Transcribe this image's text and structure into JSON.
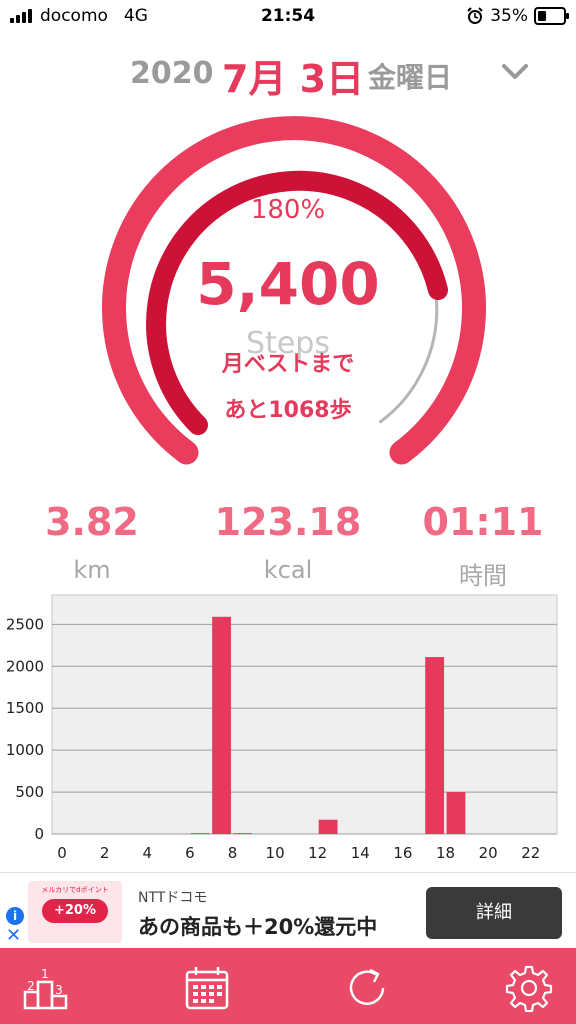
{
  "status_bar": {
    "carrier": "docomo",
    "network": "4G",
    "time": "21:54",
    "battery": "35%",
    "battery_level": 0.35,
    "icons": [
      "signal-icon",
      "alarm-icon",
      "battery-icon"
    ]
  },
  "date_header": {
    "year": "2020",
    "month_day": "7月 3日",
    "weekday": "金曜日",
    "toggle_icon": "chevron-down-icon"
  },
  "progress": {
    "percent_label": "180%",
    "percent_value": 180,
    "steps": "5,400",
    "steps_label": "Steps",
    "best_line1": "月ベストまで",
    "best_line2": "あと1068歩"
  },
  "stats": [
    {
      "value": "3.82",
      "unit": "km"
    },
    {
      "value": "123.18",
      "unit": "kcal"
    },
    {
      "value": "01:11",
      "unit": "時間"
    }
  ],
  "chart_data": {
    "type": "bar",
    "categories": [
      0,
      1,
      2,
      3,
      4,
      5,
      6,
      7,
      8,
      9,
      10,
      11,
      12,
      13,
      14,
      15,
      16,
      17,
      18,
      19,
      20,
      21,
      22,
      23
    ],
    "values": [
      0,
      0,
      0,
      0,
      0,
      0,
      10,
      2590,
      10,
      0,
      0,
      0,
      170,
      0,
      0,
      0,
      0,
      2110,
      500,
      0,
      0,
      0,
      0,
      0
    ],
    "xticks": [
      "0",
      "2",
      "4",
      "6",
      "8",
      "10",
      "12",
      "14",
      "16",
      "18",
      "20",
      "22"
    ],
    "yticks": [
      "0",
      "500",
      "1000",
      "1500",
      "2000",
      "2500"
    ],
    "ylim": [
      0,
      2500
    ],
    "grid": true,
    "bar_color": "#e53a5b"
  },
  "ad": {
    "sponsor": "NTTドコモ",
    "title": "あの商品も＋20%還元中",
    "button_label": "詳細",
    "image_badge": "+20%",
    "image_caption": "メルカリでdポイント"
  },
  "tabbar": {
    "items": [
      "ranking-icon",
      "calendar-icon",
      "refresh-icon",
      "gear-icon"
    ]
  },
  "colors": {
    "accent": "#e53a5b",
    "accent_dark": "#cc1236",
    "tabbar": "#e84a67"
  }
}
